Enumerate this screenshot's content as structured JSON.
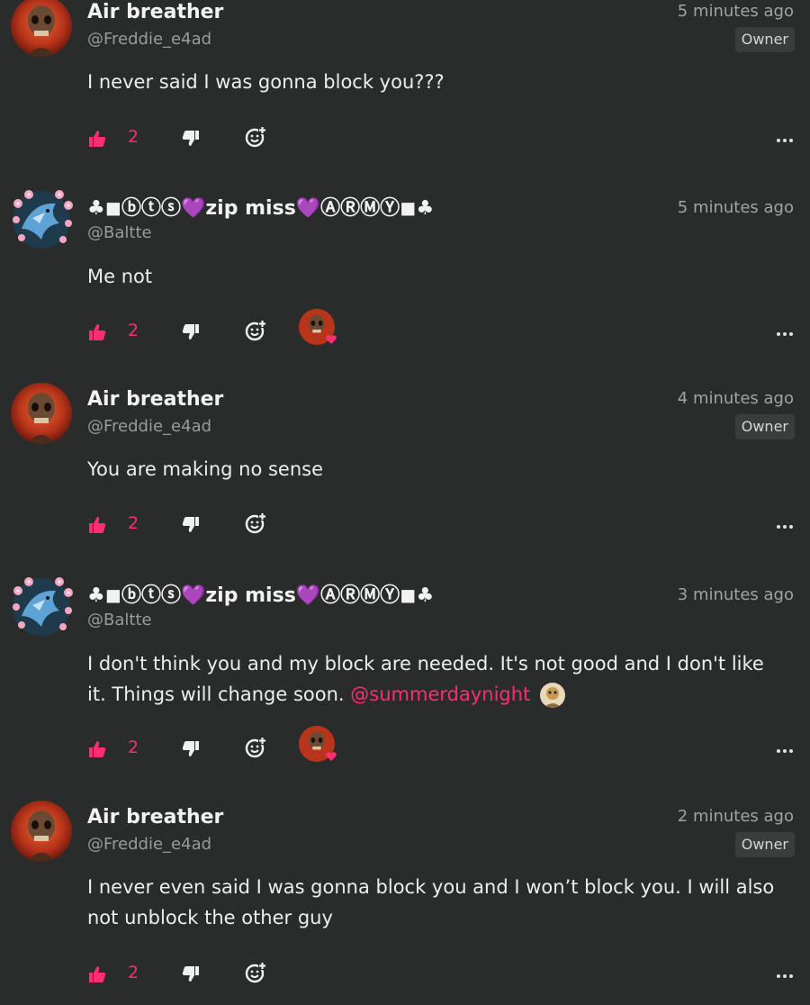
{
  "comments": [
    {
      "author": "Air breather",
      "handle": "@Freddie_e4ad",
      "time": "5 minutes ago",
      "badge": "Owner",
      "text": "I never said I was gonna block you???",
      "likes": "2",
      "avatar": "skull-avatar"
    },
    {
      "author": "♣◼ⓑⓣⓢ💜zip miss💜ⒶⓇⓂⓎ◼♣",
      "handle": "@Baltte",
      "time": "5 minutes ago",
      "text": "Me not",
      "likes": "2",
      "avatar": "dragon-avatar"
    },
    {
      "author": "Air breather",
      "handle": "@Freddie_e4ad",
      "time": "4 minutes ago",
      "badge": "Owner",
      "text": "You are making no sense",
      "likes": "2",
      "avatar": "skull-avatar"
    },
    {
      "author": "♣◼ⓑⓣⓢ💜zip miss💜ⒶⓇⓂⓎ◼♣",
      "handle": "@Baltte",
      "time": "3 minutes ago",
      "text_line1": "I don't think you and my block are needed. It's not good and I don't like",
      "text_line2": "it. Things will change soon.",
      "mention": "@summerdaynight",
      "likes": "2",
      "avatar": "dragon-avatar"
    },
    {
      "author": "Air breather",
      "handle": "@Freddie_e4ad",
      "time": "2 minutes ago",
      "badge": "Owner",
      "text_line1": "I never even said I was gonna block you and I won’t block you. I will also",
      "text_line2": "not unblock the other guy",
      "likes": "2",
      "avatar": "skull-avatar"
    }
  ],
  "colors": {
    "accent": "#ff2d72",
    "background": "#2a2c2b",
    "badge_bg": "#3b3d3c"
  }
}
